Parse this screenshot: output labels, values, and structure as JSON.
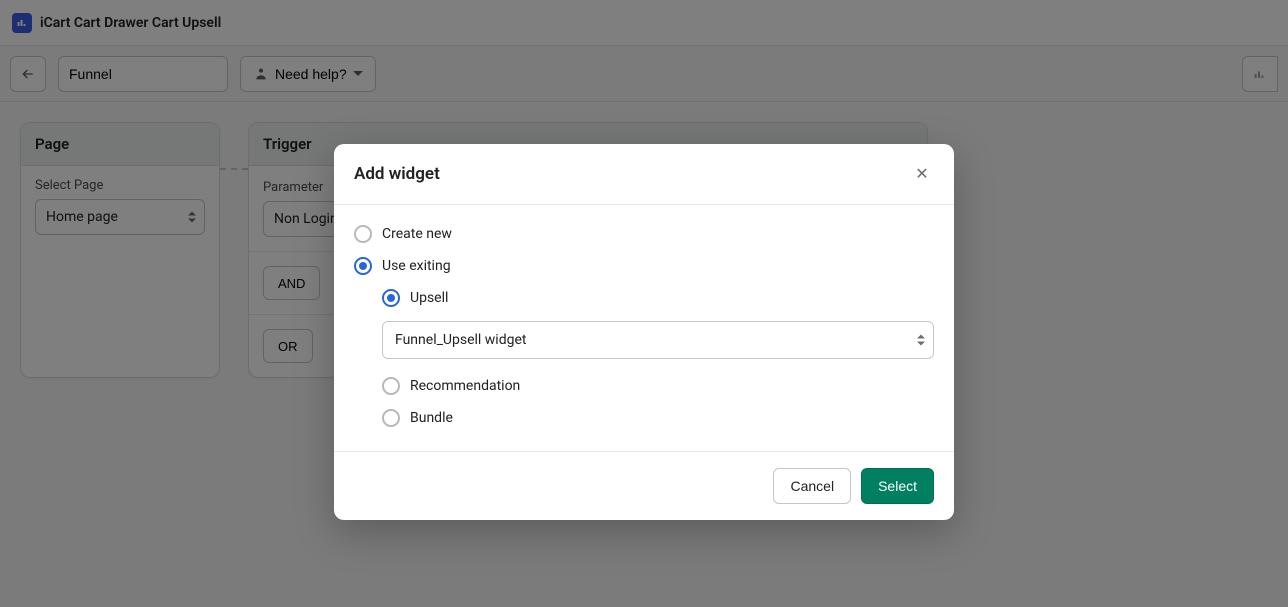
{
  "topbar": {
    "app_title": "iCart Cart Drawer Cart Upsell"
  },
  "toolbar": {
    "funnel_name": "Funnel",
    "help_label": "Need help?"
  },
  "page_card": {
    "title": "Page",
    "select_label": "Select Page",
    "select_value": "Home page"
  },
  "trigger_card": {
    "title": "Trigger",
    "param_label": "Parameter",
    "param_value": "Non Login",
    "and_label": "AND",
    "or_label": "OR"
  },
  "modal": {
    "title": "Add widget",
    "create_new": "Create new",
    "use_existing": "Use exiting",
    "upsell": "Upsell",
    "recommendation": "Recommendation",
    "bundle": "Bundle",
    "select_value": "Funnel_Upsell widget",
    "cancel": "Cancel",
    "select_btn": "Select"
  }
}
